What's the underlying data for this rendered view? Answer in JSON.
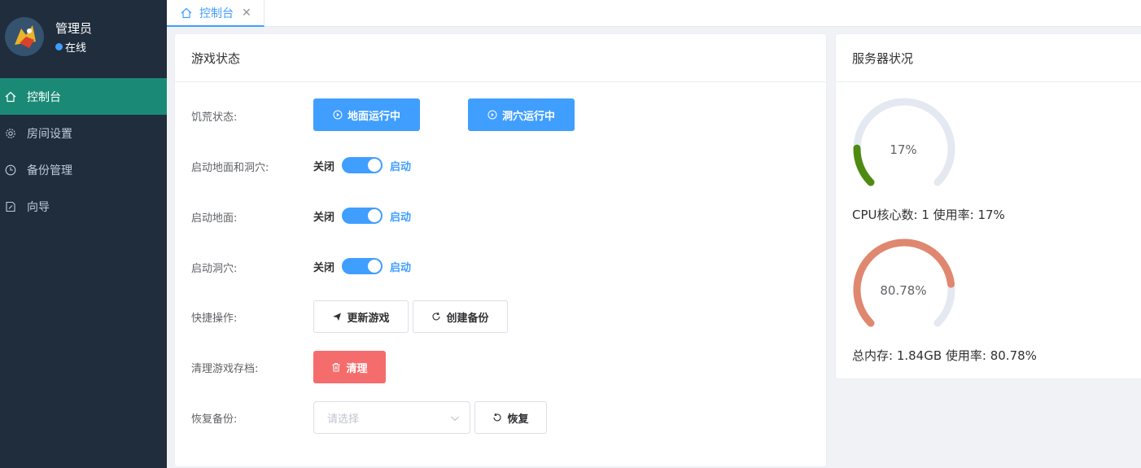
{
  "user": {
    "name": "管理员",
    "status": "在线",
    "status_color": "#409eff"
  },
  "sidebar": {
    "items": [
      {
        "label": "控制台",
        "icon": "home-icon",
        "active": true
      },
      {
        "label": "房间设置",
        "icon": "gear-icon",
        "active": false
      },
      {
        "label": "备份管理",
        "icon": "clock-icon",
        "active": false
      },
      {
        "label": "向导",
        "icon": "document-edit-icon",
        "active": false
      }
    ]
  },
  "tabs": [
    {
      "label": "控制台",
      "icon": "home-icon",
      "closable": true
    }
  ],
  "game": {
    "title": "游戏状态",
    "hunger_label": "饥荒状态:",
    "surface_running": "地面运行中",
    "cave_running": "洞穴运行中",
    "switches": [
      {
        "label": "启动地面和洞穴:",
        "off": "关闭",
        "on": "启动",
        "value": true
      },
      {
        "label": "启动地面:",
        "off": "关闭",
        "on": "启动",
        "value": true
      },
      {
        "label": "启动洞穴:",
        "off": "关闭",
        "on": "启动",
        "value": true
      }
    ],
    "quick_label": "快捷操作:",
    "update_game": "更新游戏",
    "create_backup": "创建备份",
    "clean_label": "清理游戏存档:",
    "clean_button": "清理",
    "restore_label": "恢复备份:",
    "restore_placeholder": "请选择",
    "restore_button": "恢复"
  },
  "server": {
    "title": "服务器状况",
    "cpu": {
      "percent": 17,
      "percent_text": "17%",
      "info": "CPU核心数: 1 使用率: 17%",
      "color": "#4e8a10"
    },
    "memory": {
      "percent": 80.78,
      "percent_text": "80.78%",
      "info": "总内存: 1.84GB 使用率: 80.78%",
      "color": "#e0876f"
    },
    "track_color": "#e4e8f1"
  },
  "colors": {
    "primary": "#409eff",
    "danger": "#f56c6c",
    "sidebar_bg": "#1f2d3d",
    "sidebar_active": "#1a8a76"
  }
}
